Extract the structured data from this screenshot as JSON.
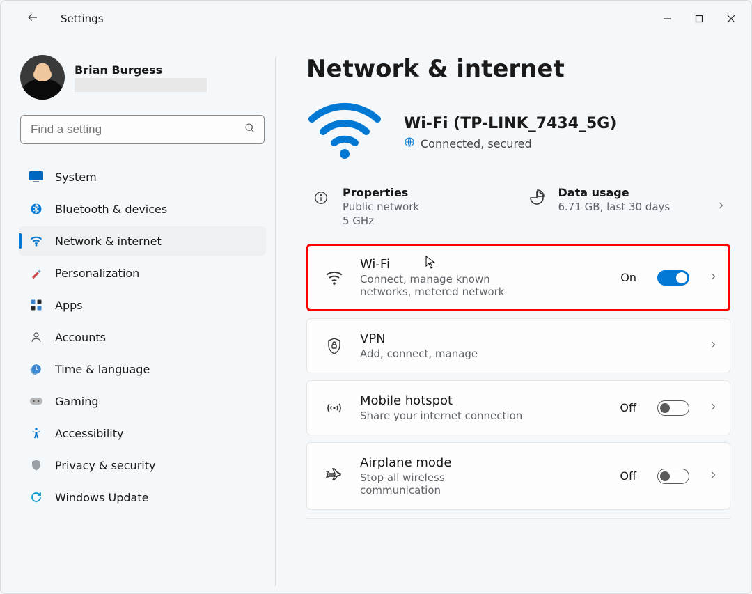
{
  "window": {
    "title": "Settings"
  },
  "user": {
    "name": "Brian Burgess"
  },
  "search": {
    "placeholder": "Find a setting"
  },
  "sidebar": {
    "items": [
      {
        "label": "System",
        "icon": "system"
      },
      {
        "label": "Bluetooth & devices",
        "icon": "bluetooth"
      },
      {
        "label": "Network & internet",
        "icon": "wifi",
        "active": true
      },
      {
        "label": "Personalization",
        "icon": "personalize"
      },
      {
        "label": "Apps",
        "icon": "apps"
      },
      {
        "label": "Accounts",
        "icon": "accounts"
      },
      {
        "label": "Time & language",
        "icon": "time"
      },
      {
        "label": "Gaming",
        "icon": "gaming"
      },
      {
        "label": "Accessibility",
        "icon": "accessibility"
      },
      {
        "label": "Privacy & security",
        "icon": "privacy"
      },
      {
        "label": "Windows Update",
        "icon": "update"
      }
    ]
  },
  "page": {
    "title": "Network & internet",
    "status": {
      "title": "Wi-Fi (TP-LINK_7434_5G)",
      "subtitle": "Connected, secured"
    },
    "infoCards": {
      "properties": {
        "title": "Properties",
        "line1": "Public network",
        "line2": "5 GHz"
      },
      "dataUsage": {
        "title": "Data usage",
        "line1": "6.71 GB, last 30 days"
      }
    },
    "settings": [
      {
        "title": "Wi-Fi",
        "sub": "Connect, manage known networks, metered network",
        "state": "On",
        "on": true,
        "highlighted": true,
        "icon": "wifi"
      },
      {
        "title": "VPN",
        "sub": "Add, connect, manage",
        "state": "",
        "on": null,
        "icon": "vpn"
      },
      {
        "title": "Mobile hotspot",
        "sub": "Share your internet connection",
        "state": "Off",
        "on": false,
        "icon": "hotspot"
      },
      {
        "title": "Airplane mode",
        "sub": "Stop all wireless communication",
        "state": "Off",
        "on": false,
        "icon": "airplane"
      }
    ]
  }
}
